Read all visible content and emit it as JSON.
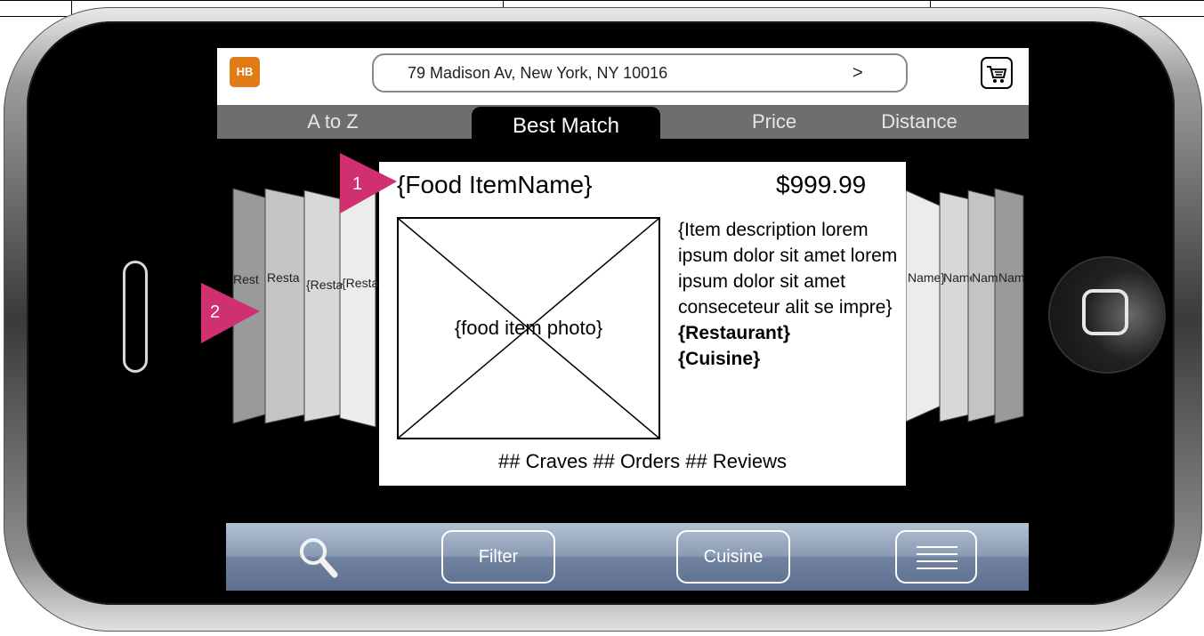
{
  "header": {
    "logo_text": "HB",
    "address": "79 Madison Av, New York, NY   10016",
    "address_go": ">",
    "cart_icon": "cart-icon"
  },
  "sort_tabs": [
    {
      "label": "A to Z"
    },
    {
      "label": "Best Match",
      "active": true
    },
    {
      "label": "Price"
    },
    {
      "label": "Distance"
    }
  ],
  "coverflow_left": [
    "Rest",
    "Resta",
    "{Resta",
    "{Restau"
  ],
  "coverflow_right": [
    "Name}",
    "Name}",
    "Name}",
    "Nam"
  ],
  "item": {
    "name": "{Food ItemName}",
    "price": "$999.99",
    "photo_label": "{food item photo}",
    "description": "{Item description lorem ipsum dolor sit amet lorem ipsum dolor sit amet conseceteur alit se impre}",
    "restaurant": "{Restaurant}",
    "cuisine": "{Cuisine}",
    "stats": "## Craves  ## Orders  ## Reviews"
  },
  "toolbar": {
    "search_icon": "search-icon",
    "filter_label": "Filter",
    "cuisine_label": "Cuisine",
    "menu_icon": "menu-icon"
  },
  "annotations": {
    "marker_1": "1",
    "marker_2": "2"
  },
  "colors": {
    "logo": "#e07b16",
    "marker": "#d0306f",
    "sortbar": "#6e6e6e",
    "toolbar": "#8a9bb3"
  }
}
